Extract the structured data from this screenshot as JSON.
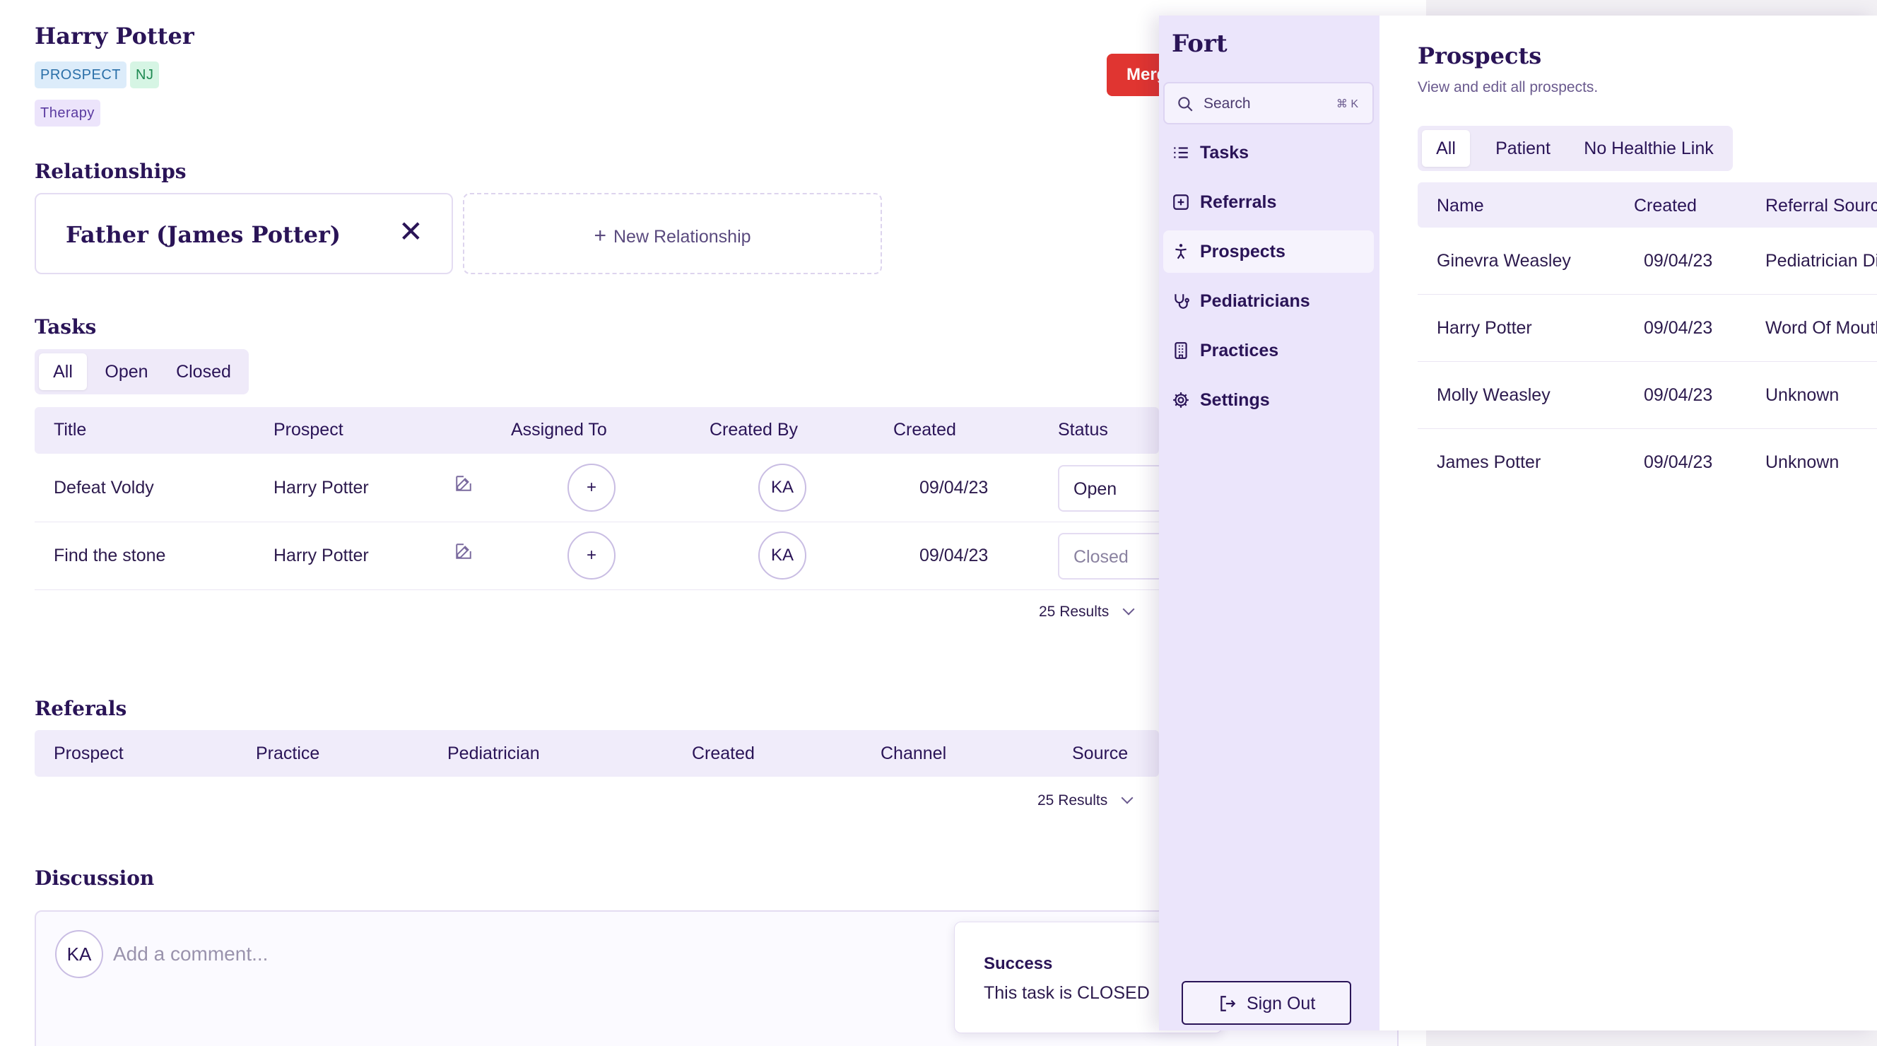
{
  "prospect": {
    "name": "Harry Potter",
    "tags": [
      "PROSPECT",
      "NJ",
      "Therapy"
    ],
    "merge_label": "Merge"
  },
  "relationships": {
    "title": "Relationships",
    "items": [
      {
        "label": "Father (James Potter)"
      }
    ],
    "new_label": "New Relationship"
  },
  "tasks": {
    "title": "Tasks",
    "filters": [
      "All",
      "Open",
      "Closed"
    ],
    "active_filter": "All",
    "columns": [
      "Title",
      "Prospect",
      "Assigned To",
      "Created By",
      "Created",
      "Status"
    ],
    "rows": [
      {
        "title": "Defeat Voldy",
        "prospect": "Harry Potter",
        "assigned": "+",
        "created_by": "KA",
        "created": "09/04/23",
        "status": "Open"
      },
      {
        "title": "Find the stone",
        "prospect": "Harry Potter",
        "assigned": "+",
        "created_by": "KA",
        "created": "09/04/23",
        "status": "Closed"
      }
    ],
    "results_label": "25 Results"
  },
  "referrals": {
    "title": "Referals",
    "columns": [
      "Prospect",
      "Practice",
      "Pediatrician",
      "Created",
      "Channel",
      "Source"
    ],
    "results_label": "25 Results"
  },
  "discussion": {
    "title": "Discussion",
    "avatar": "KA",
    "placeholder": "Add a comment..."
  },
  "toast": {
    "title": "Success",
    "message": "This task is CLOSED"
  },
  "app": {
    "brand": "Fort",
    "search": {
      "label": "Search",
      "shortcut": "⌘ K"
    },
    "nav": [
      {
        "label": "Tasks",
        "icon": "list-icon"
      },
      {
        "label": "Referrals",
        "icon": "plus-square-icon"
      },
      {
        "label": "Prospects",
        "icon": "person-icon",
        "active": true
      },
      {
        "label": "Pediatricians",
        "icon": "stethoscope-icon"
      },
      {
        "label": "Practices",
        "icon": "building-icon"
      },
      {
        "label": "Settings",
        "icon": "gear-icon"
      }
    ],
    "sign_out": "Sign Out"
  },
  "prospects_page": {
    "title": "Prospects",
    "subtitle": "View and edit all prospects.",
    "filters": [
      "All",
      "Patient",
      "No Healthie Link"
    ],
    "active_filter": "All",
    "columns": [
      "Name",
      "Created",
      "Referral Source"
    ],
    "rows": [
      {
        "name": "Ginevra Weasley",
        "created": "09/04/23",
        "source": "Pediatrician Direct"
      },
      {
        "name": "Harry Potter",
        "created": "09/04/23",
        "source": "Word Of Mouth"
      },
      {
        "name": "Molly Weasley",
        "created": "09/04/23",
        "source": "Unknown"
      },
      {
        "name": "James Potter",
        "created": "09/04/23",
        "source": "Unknown"
      }
    ]
  },
  "colors": {
    "primary": "#2a1457",
    "danger": "#e03531",
    "sidebar_bg": "#ebe5fb",
    "header_bg": "#f0ecfa"
  }
}
